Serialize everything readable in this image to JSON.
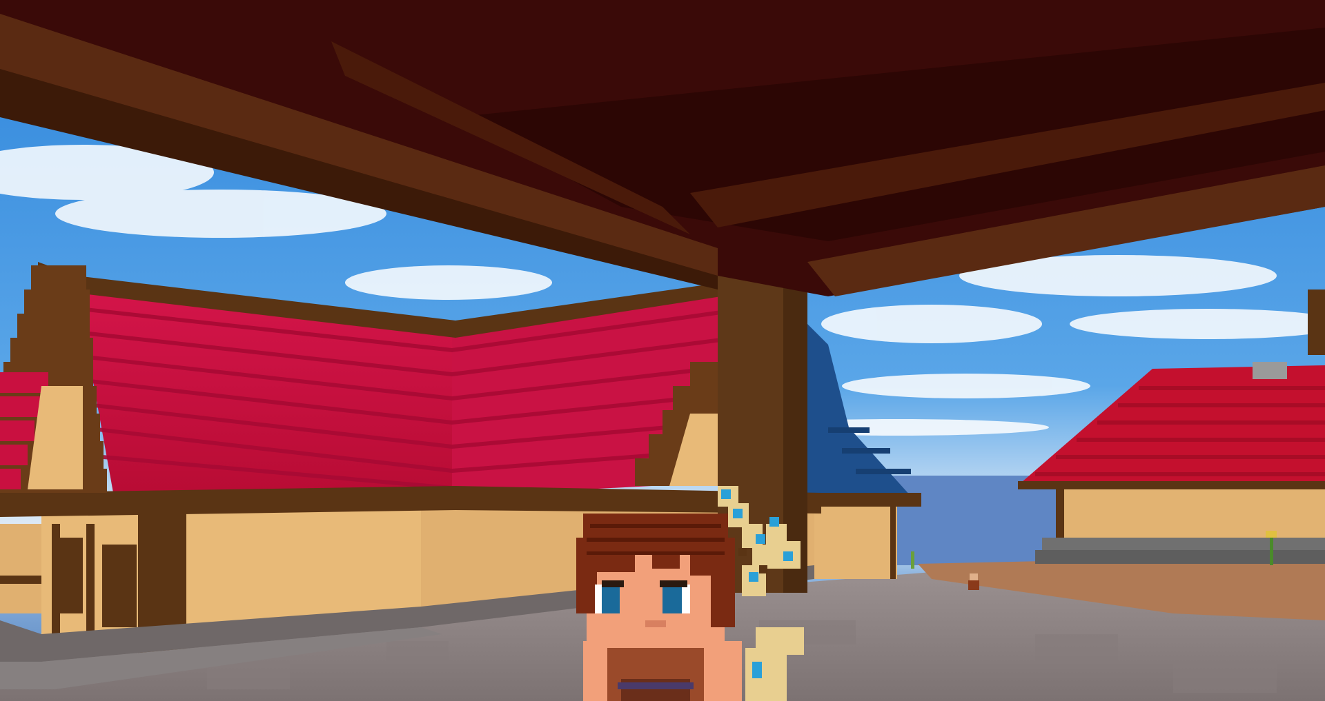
{
  "scene": {
    "description_name": "voxel-village-3d-view",
    "colors": {
      "sky_top": "#2f86dc",
      "sky_horizon": "#dfeaf6",
      "ceiling": "#3a0a08",
      "beam": "#5a2a12",
      "roof_red": "#c4103a",
      "roof_red_light": "#d81a46",
      "wall_tan": "#e7b876",
      "timber": "#5a3414",
      "floor_stone": "#8a8080",
      "dirt": "#b07a55",
      "blue_roof": "#1e4f8c",
      "skin": "#f2a07a",
      "hair": "#7a2a12",
      "bow_gold": "#e8cf90",
      "bow_accent": "#2aa0d8"
    },
    "entities": [
      "player-character",
      "bow-weapon",
      "distant-npc"
    ]
  }
}
